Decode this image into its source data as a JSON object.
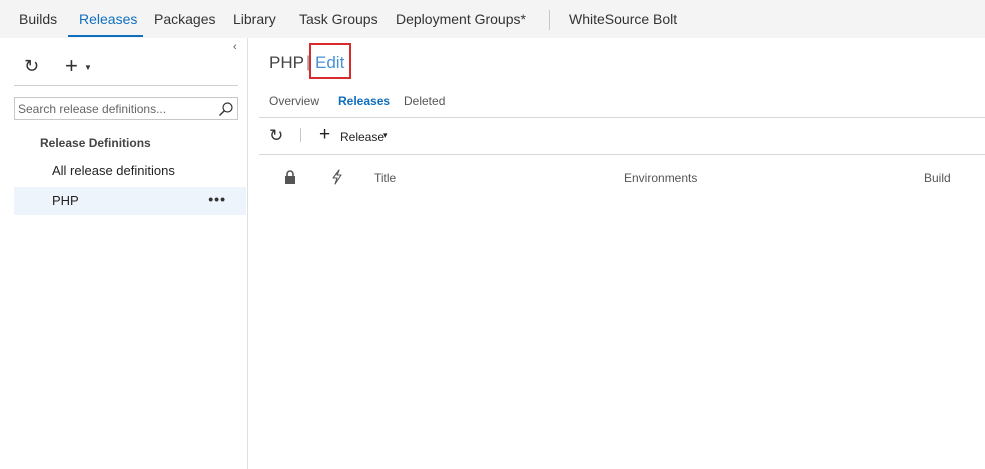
{
  "nav": {
    "items": [
      {
        "label": "Builds"
      },
      {
        "label": "Releases"
      },
      {
        "label": "Packages"
      },
      {
        "label": "Library"
      },
      {
        "label": "Task Groups"
      },
      {
        "label": "Deployment Groups*"
      },
      {
        "label": "WhiteSource Bolt"
      }
    ],
    "active": "Releases"
  },
  "left": {
    "collapse_glyph": "‹",
    "refresh_glyph": "↻",
    "add_glyph": "+",
    "search_placeholder": "Search release definitions...",
    "section_header": "Release Definitions",
    "items": [
      {
        "label": "All release definitions"
      },
      {
        "label": "PHP",
        "more": "•••"
      }
    ],
    "selected": "PHP"
  },
  "main": {
    "title": "PHP",
    "separator": "|",
    "edit_label": "Edit",
    "tabs": [
      {
        "label": "Overview"
      },
      {
        "label": "Releases"
      },
      {
        "label": "Deleted"
      }
    ],
    "active_tab": "Releases",
    "toolbar": {
      "refresh_glyph": "↻",
      "add_glyph": "+",
      "release_label": "Release",
      "caret_glyph": "▾"
    },
    "columns": {
      "lock_icon": "lock-icon",
      "trigger_icon": "lightning-icon",
      "title": "Title",
      "environments": "Environments",
      "build": "Build"
    }
  },
  "colors": {
    "accent": "#106ebe",
    "link": "#4a90d9",
    "highlight_box": "#d92b2b",
    "nav_bg": "#f4f4f4",
    "selected_bg": "#eef4fb"
  }
}
